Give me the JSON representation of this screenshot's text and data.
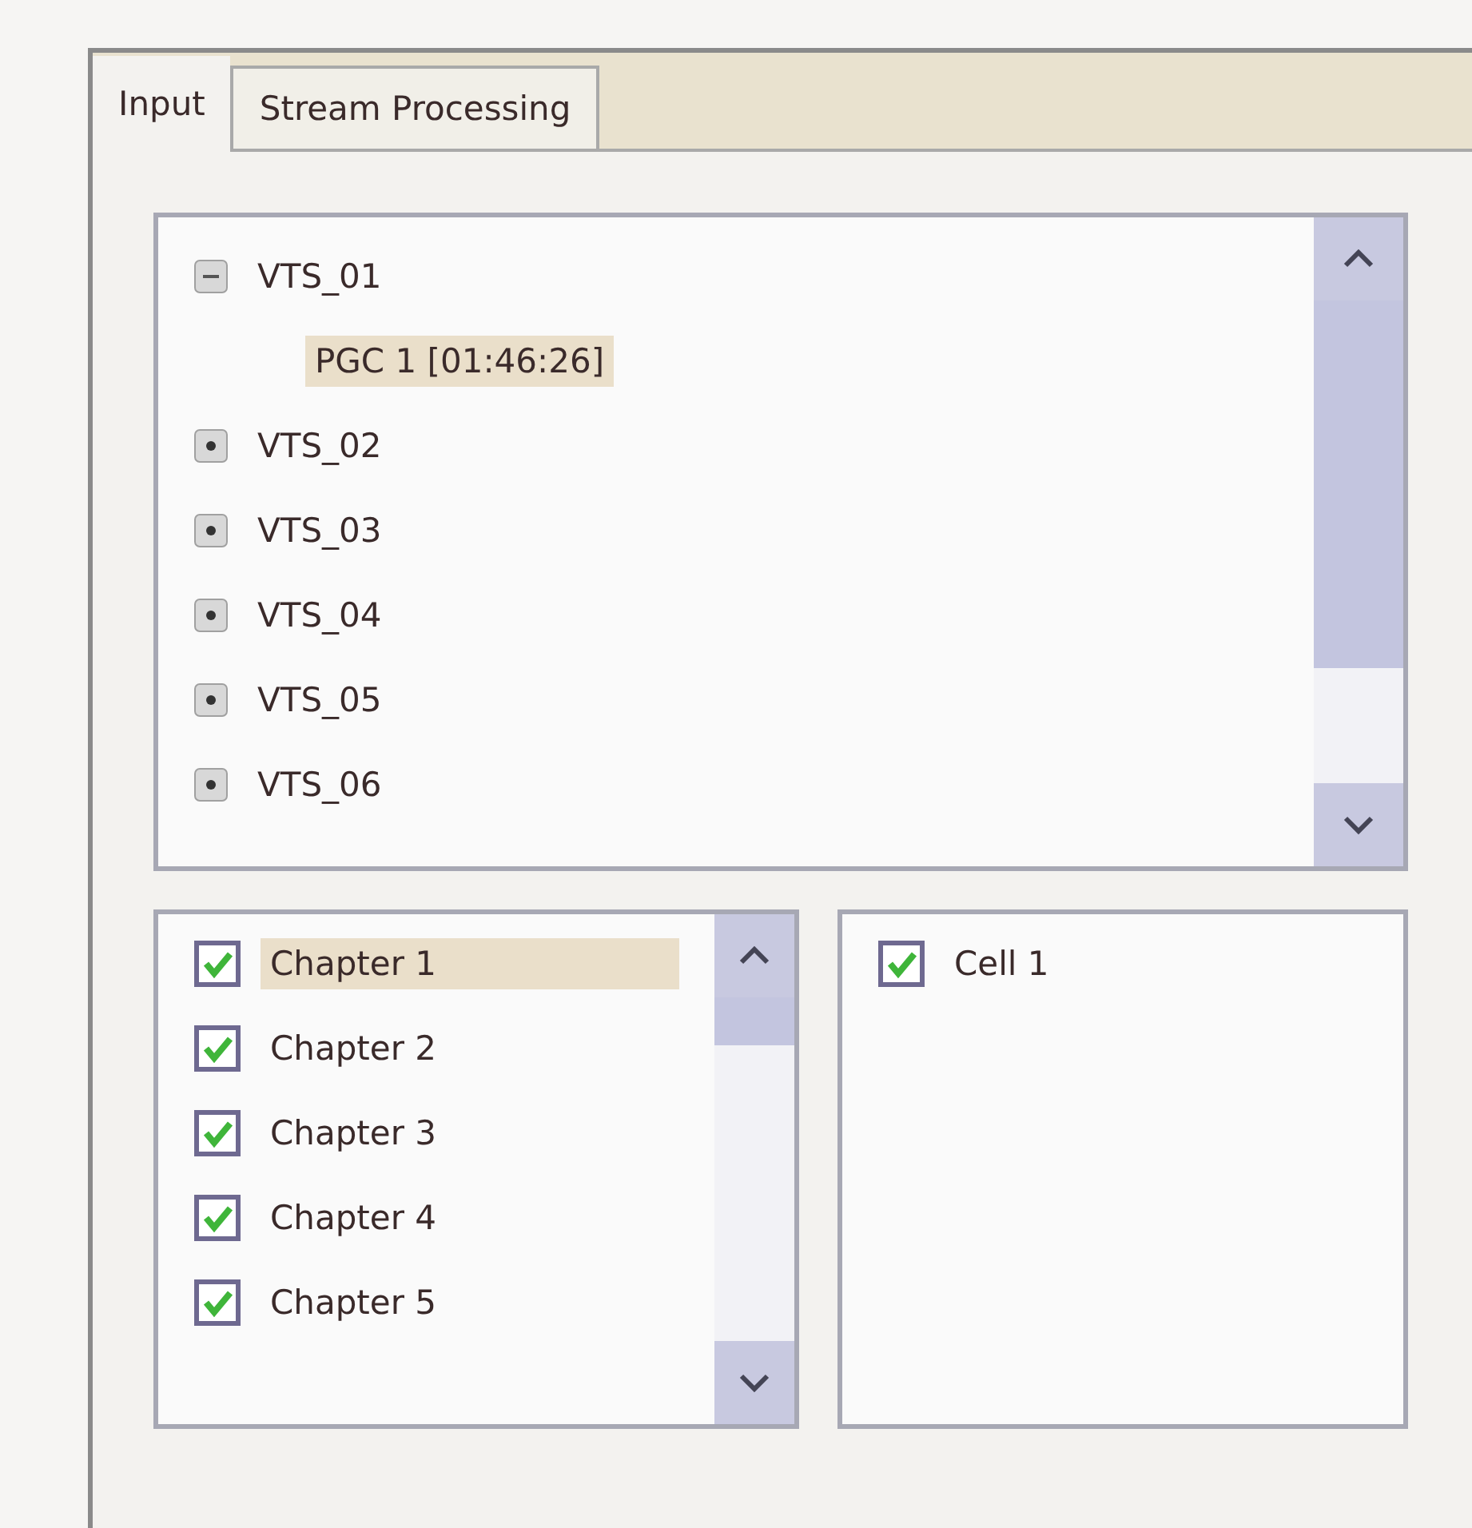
{
  "tabs": [
    {
      "label": "Input",
      "selected": true
    },
    {
      "label": "Stream Processing",
      "selected": false
    }
  ],
  "title_tree": [
    {
      "label": "VTS_01",
      "expanded": true,
      "selected": false,
      "children": [
        {
          "label": "PGC 1 [01:46:26]",
          "selected": true
        }
      ]
    },
    {
      "label": "VTS_02",
      "expanded": false,
      "selected": false
    },
    {
      "label": "VTS_03",
      "expanded": false,
      "selected": false
    },
    {
      "label": "VTS_04",
      "expanded": false,
      "selected": false
    },
    {
      "label": "VTS_05",
      "expanded": false,
      "selected": false
    },
    {
      "label": "VTS_06",
      "expanded": false,
      "selected": false
    }
  ],
  "chapters": [
    {
      "label": "Chapter 1",
      "checked": true,
      "selected": true
    },
    {
      "label": "Chapter 2",
      "checked": true,
      "selected": false
    },
    {
      "label": "Chapter 3",
      "checked": true,
      "selected": false
    },
    {
      "label": "Chapter 4",
      "checked": true,
      "selected": false
    },
    {
      "label": "Chapter 5",
      "checked": true,
      "selected": false
    }
  ],
  "cells": [
    {
      "label": "Cell 1",
      "checked": true,
      "selected": false
    }
  ]
}
